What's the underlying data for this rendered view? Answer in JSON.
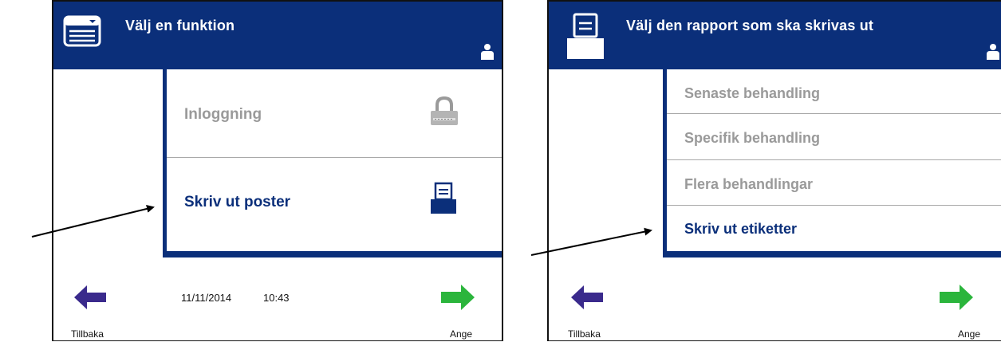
{
  "left_screen": {
    "title": "Välj en funktion",
    "menu": [
      {
        "label": "Inloggning",
        "state": "disabled",
        "icon": "lock-icon"
      },
      {
        "label": "Skriv ut poster",
        "state": "active",
        "icon": "printer-icon"
      }
    ],
    "footer": {
      "back_label": "Tillbaka",
      "next_label": "Ange",
      "date": "11/11/2014",
      "time": "10:43"
    }
  },
  "right_screen": {
    "title": "Välj den rapport som ska skrivas ut",
    "menu": [
      {
        "label": "Senaste behandling",
        "state": "disabled"
      },
      {
        "label": "Specifik behandling",
        "state": "disabled"
      },
      {
        "label": "Flera behandlingar",
        "state": "disabled"
      },
      {
        "label": "Skriv ut etiketter",
        "state": "active"
      }
    ],
    "footer": {
      "back_label": "Tillbaka",
      "next_label": "Ange"
    }
  },
  "colors": {
    "header_blue": "#0b2f7a",
    "back_arrow": "#3a2a8c",
    "next_arrow": "#2bb53c",
    "disabled_text": "#9a9a9a"
  }
}
